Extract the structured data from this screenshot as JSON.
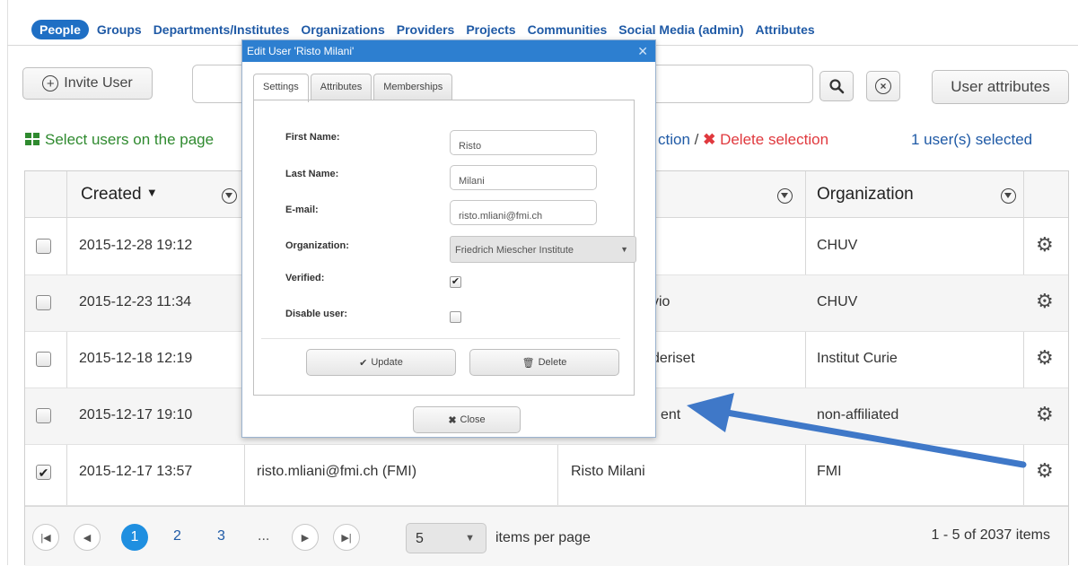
{
  "nav": {
    "tabs": [
      "People",
      "Groups",
      "Departments/Institutes",
      "Organizations",
      "Providers",
      "Projects",
      "Communities",
      "Social Media (admin)",
      "Attributes"
    ]
  },
  "toolbar": {
    "invite_label": "Invite User",
    "search_value": "",
    "attributes_label": "User attributes"
  },
  "selection": {
    "select_page": "Select users on the page",
    "invert_partial": "ction",
    "separator": " / ",
    "delete_label": "Delete selection",
    "count": "1 user(s) selected"
  },
  "table": {
    "headers": {
      "created": "Created",
      "name": "",
      "organization": "Organization"
    },
    "rows": [
      {
        "created": "2015-12-28 19:12",
        "email": "",
        "name": "",
        "org": "CHUV",
        "checked": false
      },
      {
        "created": "2015-12-23 11:34",
        "email": "",
        "name": "vio",
        "org": "CHUV",
        "checked": false
      },
      {
        "created": "2015-12-18 12:19",
        "email": "",
        "name": "deriset",
        "org": "Institut Curie",
        "checked": false
      },
      {
        "created": "2015-12-17 19:10",
        "email": "",
        "name": "ent",
        "org": "non-affiliated",
        "checked": false
      },
      {
        "created": "2015-12-17 13:57",
        "email": "risto.mliani@fmi.ch (FMI)",
        "name": "Risto Milani",
        "org": "FMI",
        "checked": true
      }
    ]
  },
  "pager": {
    "pages": [
      "1",
      "2",
      "3",
      "..."
    ],
    "current_page": 1,
    "per_page": "5",
    "per_page_label": "items per page",
    "info": "1 - 5 of 2037 items"
  },
  "dialog": {
    "title": "Edit User 'Risto Milani'",
    "tabs": [
      "Settings",
      "Attributes",
      "Memberships"
    ],
    "labels": {
      "first_name": "First Name:",
      "last_name": "Last Name:",
      "email": "E-mail:",
      "organization": "Organization:",
      "verified": "Verified:",
      "disable": "Disable user:"
    },
    "values": {
      "first_name": "Risto",
      "last_name": "Milani",
      "email": "risto.mliani@fmi.ch",
      "organization": "Friedrich Miescher Institute",
      "verified": true,
      "disabled": false
    },
    "update_label": "Update",
    "delete_label": "Delete",
    "close_label": "Close"
  },
  "colors": {
    "accent": "#1f6fc4",
    "link": "#1f5aa6",
    "danger": "#e0393e",
    "success": "#2f8a2f",
    "arrow": "#3f78c8"
  },
  "icons": [
    "plus-circle-icon",
    "search-icon",
    "clear-icon",
    "grid-icon",
    "close-x-icon",
    "filter-icon",
    "sort-desc-icon",
    "gear-icon",
    "first-page-icon",
    "prev-page-icon",
    "next-page-icon",
    "last-page-icon",
    "check-icon",
    "trash-icon",
    "dropdown-arrow-icon",
    "annotation-arrow"
  ]
}
